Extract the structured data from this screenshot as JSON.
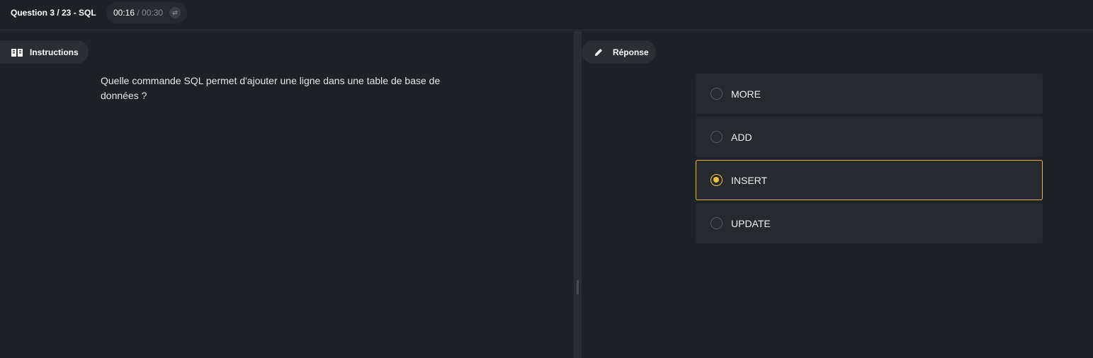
{
  "header": {
    "question_title": "Question 3 / 23 - SQL",
    "timer_elapsed": "00:16",
    "timer_separator": " / ",
    "timer_total": "00:30",
    "timer_icon": "swap-icon"
  },
  "instructions": {
    "tab_label": "Instructions",
    "tab_icon": "book-icon",
    "question_text": "Quelle commande SQL permet d'ajouter une ligne dans une table de base de données ?"
  },
  "response": {
    "tab_label": "Réponse",
    "tab_icon": "pencil-icon",
    "options": [
      {
        "label": "MORE",
        "selected": false
      },
      {
        "label": "ADD",
        "selected": false
      },
      {
        "label": "INSERT",
        "selected": true
      },
      {
        "label": "UPDATE",
        "selected": false
      }
    ]
  },
  "colors": {
    "background": "#1e2125",
    "accent": "#f0c23c"
  }
}
